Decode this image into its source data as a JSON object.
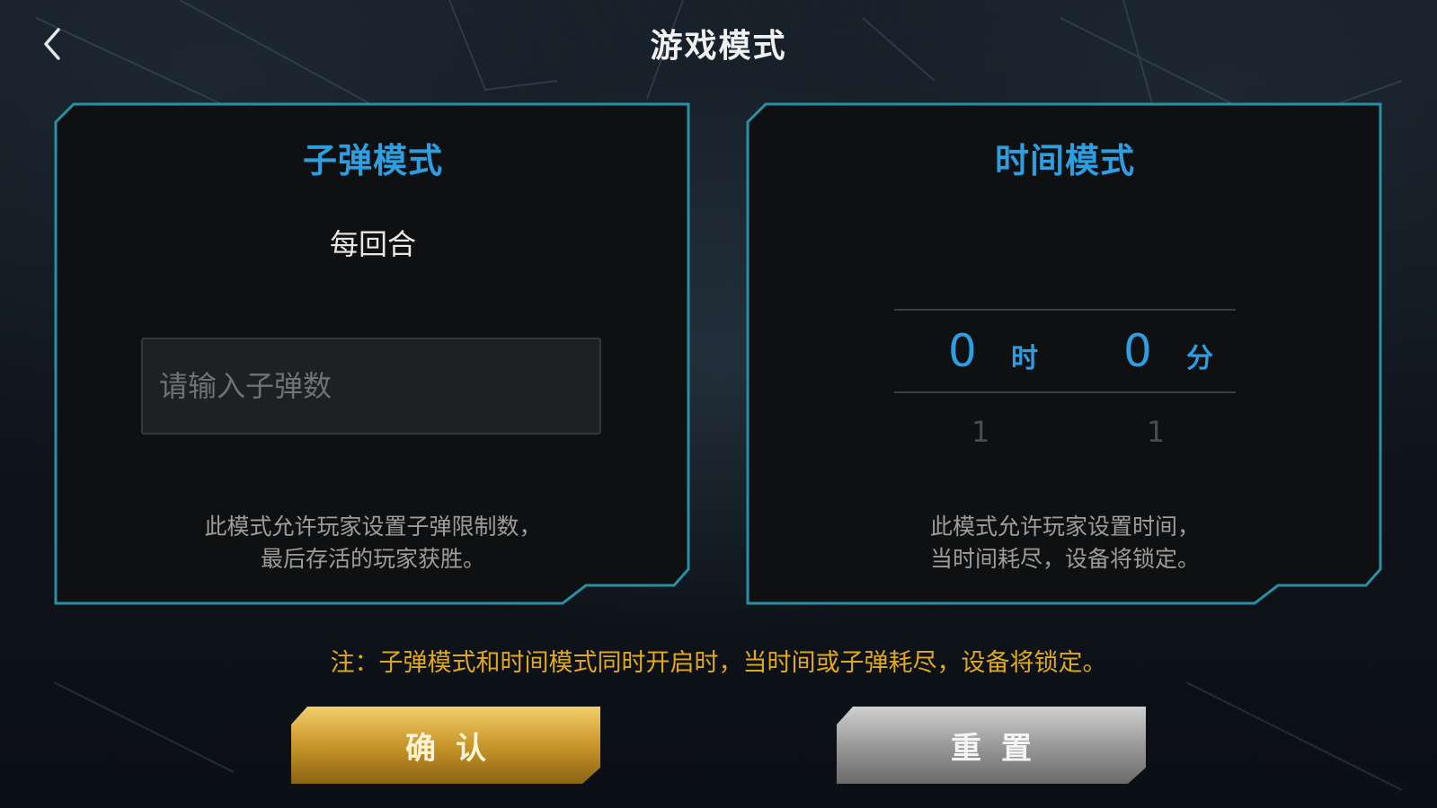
{
  "header": {
    "title": "游戏模式",
    "back_icon": "chevron-left-icon"
  },
  "bullet_mode": {
    "title": "子弹模式",
    "per_round_label": "每回合",
    "input_placeholder": "请输入子弹数",
    "input_value": "",
    "description_lines": [
      "此模式允许玩家设置子弹限制数，",
      "最后存活的玩家获胜。"
    ]
  },
  "time_mode": {
    "title": "时间模式",
    "hours": {
      "value": "0",
      "unit": "时",
      "next_value": "1"
    },
    "minutes": {
      "value": "0",
      "unit": "分",
      "next_value": "1"
    },
    "description_lines": [
      "此模式允许玩家设置时间，",
      "当时间耗尽，设备将锁定。"
    ]
  },
  "note": "注：子弹模式和时间模式同时开启时，当时间或子弹耗尽，设备将锁定。",
  "buttons": {
    "confirm_label": "确认",
    "reset_label": "重置"
  },
  "colors": {
    "accent_blue": "#2f9ee0",
    "panel_border": "#2a8fa4",
    "note_gold": "#e0a81e",
    "confirm_gold": "#c9962a",
    "reset_gray": "#9a9a9a"
  }
}
